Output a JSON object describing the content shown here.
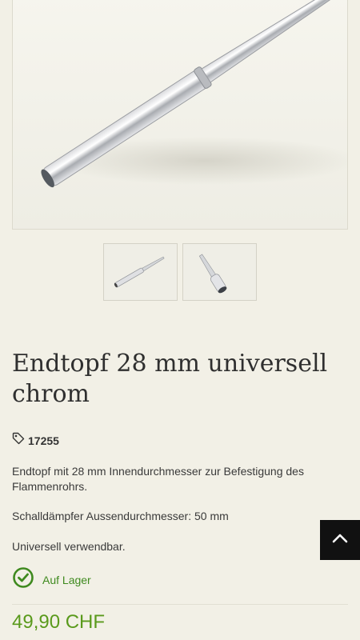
{
  "product": {
    "title": "Endtopf 28 mm universell chrom",
    "sku": "17255",
    "description": [
      "Endtopf mit 28 mm Innendurchmesser zur Befestigung des Flammenrohrs.",
      "Schalldämpfer Aussendurchmesser: 50 mm",
      "Universell verwendbar."
    ],
    "stock_status": "Auf Lager",
    "price": "49,90 CHF"
  },
  "icons": {
    "sku": "tag-icon",
    "stock": "check-circle-icon",
    "scroll_top": "chevron-up-icon"
  },
  "colors": {
    "background": "#f2f0e6",
    "stock_green": "#3f8a1f",
    "price_green": "#5a9a1c",
    "scroll_button": "#111111"
  }
}
